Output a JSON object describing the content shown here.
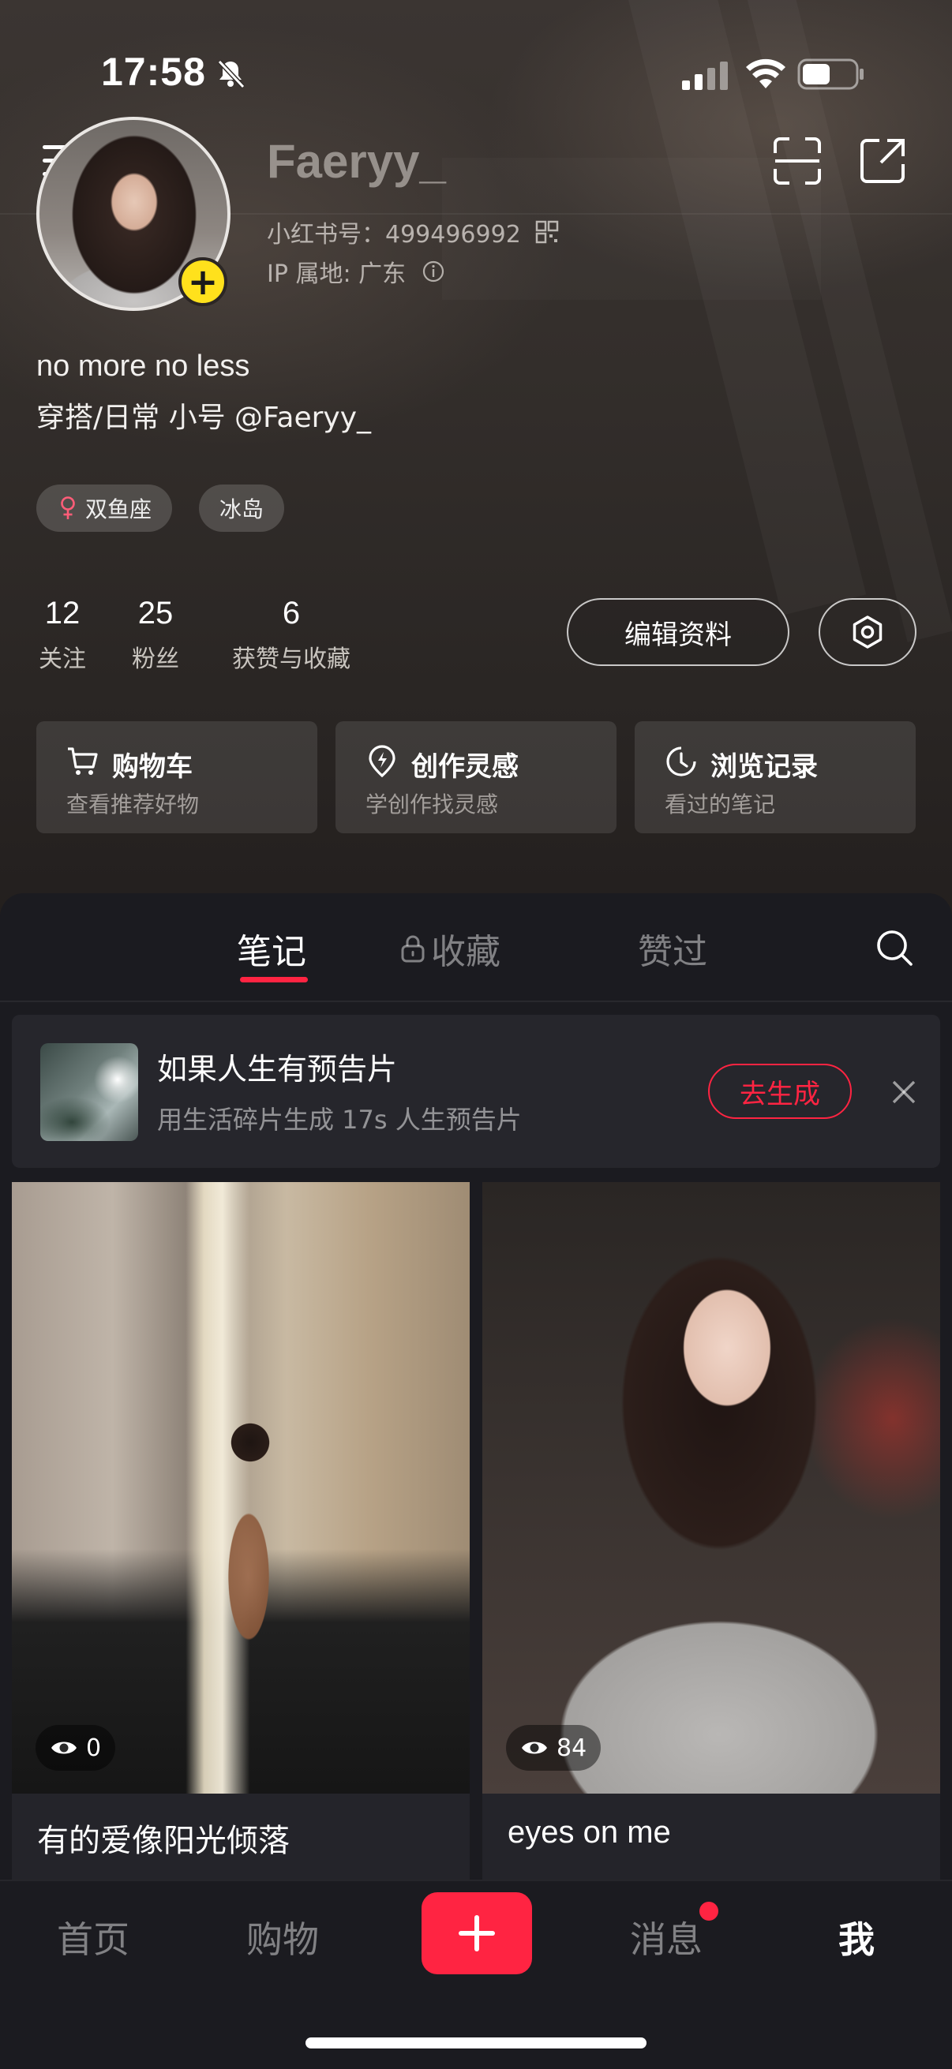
{
  "status_bar": {
    "time": "17:58",
    "icons": [
      "bell-slash-icon",
      "signal-icon",
      "wifi-icon",
      "battery-icon"
    ]
  },
  "profile": {
    "username": "Faeryy_",
    "red_id": "小红书号：499496992",
    "ip_location": "IP 属地: 广东",
    "bio_line1": "no more no less",
    "bio_line2": "穿搭/日常 小号 @Faeryy_",
    "tags": [
      "双鱼座",
      "冰岛"
    ],
    "stats": [
      {
        "value": "12",
        "label": "关注"
      },
      {
        "value": "25",
        "label": "粉丝"
      },
      {
        "value": "6",
        "label": "获赞与收藏"
      }
    ],
    "edit_label": "编辑资料"
  },
  "quick_cards": [
    {
      "icon": "cart-icon",
      "title": "购物车",
      "subtitle": "查看推荐好物"
    },
    {
      "icon": "lightbulb-icon",
      "title": "创作灵感",
      "subtitle": "学创作找灵感"
    },
    {
      "icon": "clock-icon",
      "title": "浏览记录",
      "subtitle": "看过的笔记"
    }
  ],
  "tabs": [
    {
      "label": "笔记",
      "active": true
    },
    {
      "label": "收藏",
      "active": false,
      "locked": true
    },
    {
      "label": "赞过",
      "active": false
    }
  ],
  "banner": {
    "title": "如果人生有预告片",
    "subtitle": "用生活碎片生成 17s 人生预告片",
    "button": "去生成"
  },
  "notes": [
    {
      "views": "0",
      "title": "有的爱像阳光倾落"
    },
    {
      "views": "84",
      "title": "eyes on me"
    }
  ],
  "bottom_nav": {
    "items": [
      "首页",
      "购物",
      "消息",
      "我"
    ],
    "active": "我"
  },
  "colors": {
    "accent": "#ff2442",
    "avatar_badge": "#ffe11c",
    "background": "#1b1b20"
  }
}
